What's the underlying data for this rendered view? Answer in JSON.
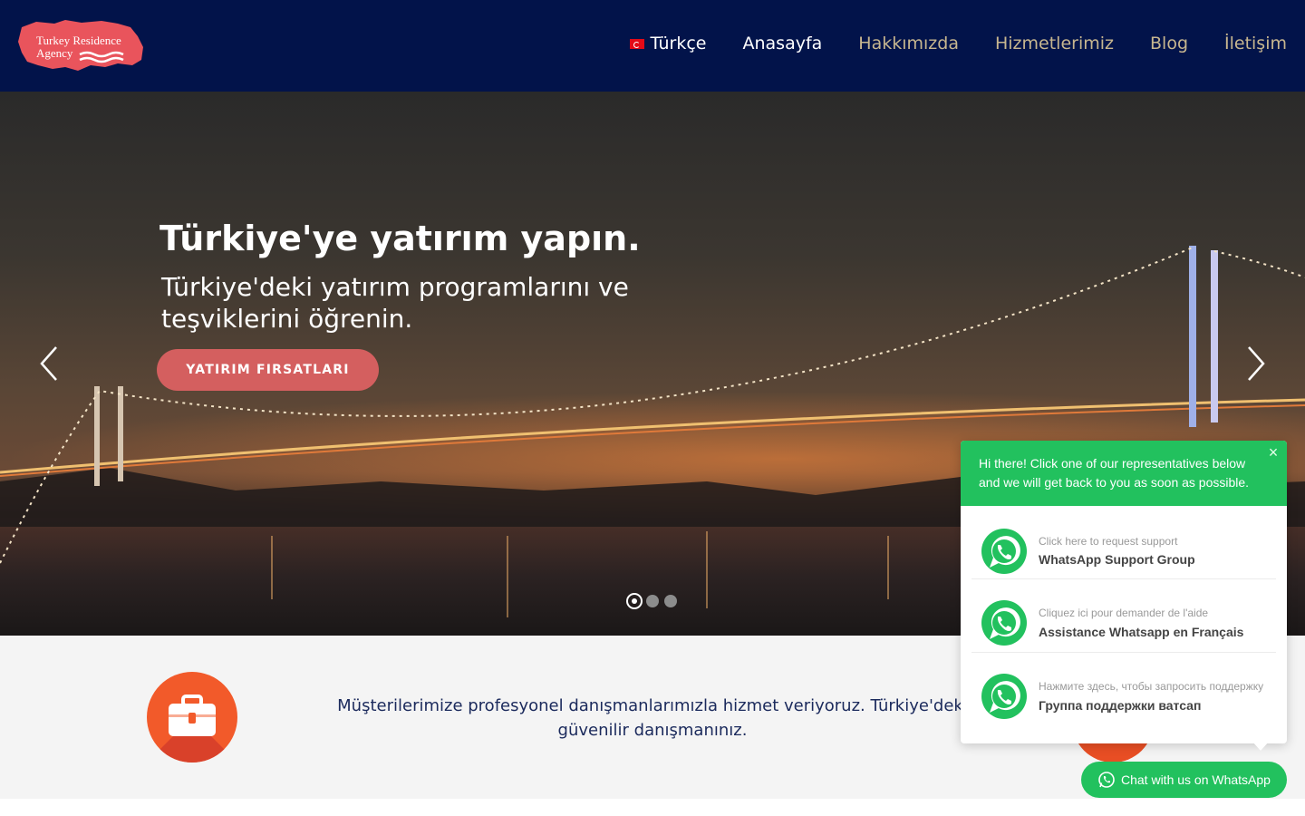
{
  "header": {
    "logo_text_line1": "Turkey Residence",
    "logo_text_line2": "Agency",
    "nav": {
      "language": "Türkçe",
      "home": "Anasayfa",
      "about": "Hakkımızda",
      "services": "Hizmetlerimiz",
      "blog": "Blog",
      "contact": "İletişim"
    }
  },
  "hero": {
    "title": "Türkiye'ye yatırım yapın.",
    "subtitle": "Türkiye'deki yatırım programlarını ve teşviklerini öğrenin.",
    "cta": "YATIRIM FIRSATLARI",
    "slide_count": 3,
    "active_slide": 1
  },
  "below": {
    "text": "Müşterilerimize profesyonel danışmanlarımızla hizmet veriyoruz. Türkiye'deki güvenilir danışmanınız."
  },
  "whatsapp": {
    "header_text": "Hi there! Click one of our representatives below and we will get back to you as soon as possible.",
    "close_icon": "×",
    "agents": [
      {
        "small": "Click here to request support",
        "name": "WhatsApp Support Group"
      },
      {
        "small": "Cliquez ici pour demander de l'aide",
        "name": "Assistance Whatsapp en Français"
      },
      {
        "small": "Нажмите здесь, чтобы запросить поддержку",
        "name": "Группа поддержки ватсап"
      }
    ],
    "button_label": "Chat with us on WhatsApp",
    "brand_color": "#22c15e"
  },
  "colors": {
    "header_bg": "#02134a",
    "nav_gold": "#c7b68f",
    "cta_bg": "#d45f5f",
    "text_navy": "#1b2a5c"
  }
}
